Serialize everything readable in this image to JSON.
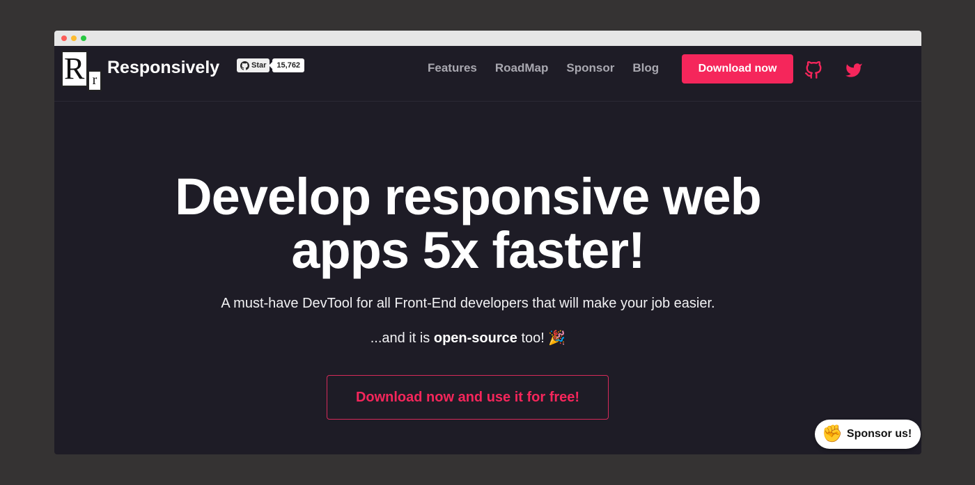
{
  "window": {
    "controls": [
      "close",
      "minimize",
      "zoom"
    ]
  },
  "header": {
    "logo_letters": [
      "R",
      "r"
    ],
    "brand": "Responsively",
    "github_star": {
      "label": "Star",
      "count": "15,762",
      "icon": "github-icon"
    },
    "nav": [
      {
        "label": "Features"
      },
      {
        "label": "RoadMap"
      },
      {
        "label": "Sponsor"
      },
      {
        "label": "Blog"
      }
    ],
    "download_label": "Download now",
    "social": [
      {
        "icon": "github-icon",
        "color": "#f5265b"
      },
      {
        "icon": "twitter-icon",
        "color": "#f5265b"
      }
    ]
  },
  "hero": {
    "title_line1": "Develop responsive web",
    "title_line2": "apps 5x faster!",
    "subtitle": "A must-have DevTool for all Front-End developers that will make your job easier.",
    "open_prefix": "...and it is",
    "open_bold": "open-source",
    "open_suffix": "too!",
    "open_emoji": "🎉",
    "cta_label": "Download now and use it for free!"
  },
  "sponsor_pill": {
    "emoji": "✊",
    "label": "Sponsor us!"
  },
  "colors": {
    "accent": "#f5265b",
    "background": "#1e1c26",
    "page": "#353333"
  }
}
